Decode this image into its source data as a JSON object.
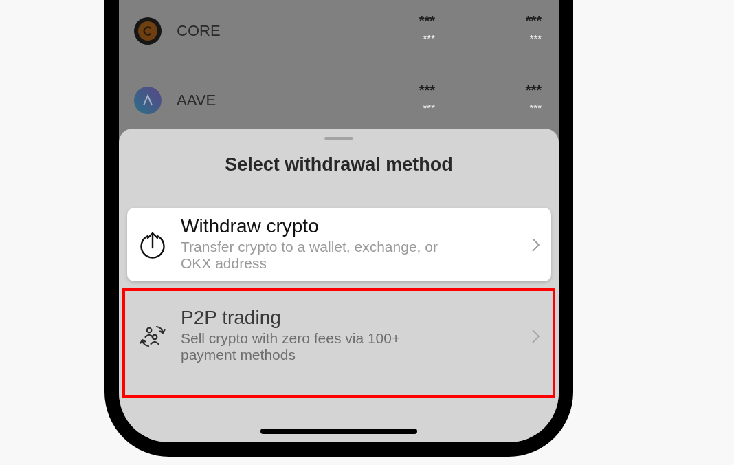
{
  "asset_list": [
    {
      "name": "CORE",
      "columns": [
        {
          "line_1": "***",
          "line_2": "***"
        },
        {
          "line_1": "***",
          "line_2": "***"
        }
      ]
    },
    {
      "name": "AAVE",
      "columns": [
        {
          "line_1": "***",
          "line_2": "***"
        },
        {
          "line_1": "***",
          "line_2": "***"
        }
      ]
    }
  ],
  "sheet": {
    "title": "Select withdrawal method",
    "methods": [
      {
        "kind": "withdraw",
        "title": "Withdraw crypto",
        "description": "Transfer crypto to a wallet, exchange, or OKX address",
        "disabled": false,
        "highlighted": false
      },
      {
        "kind": "p2p",
        "title": "P2P trading",
        "description": "Sell crypto with zero fees via 100+ payment methods",
        "disabled": true,
        "highlighted": true
      }
    ]
  }
}
